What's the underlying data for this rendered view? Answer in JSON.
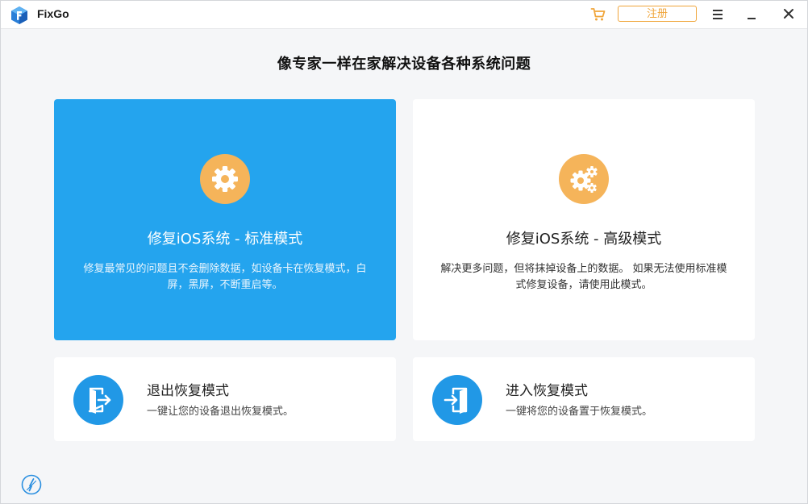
{
  "app": {
    "title": "FixGo"
  },
  "titlebar": {
    "register_label": "注册",
    "icons": [
      "cart-icon",
      "menu-icon",
      "minimize-icon",
      "close-icon"
    ]
  },
  "headline": "像专家一样在家解决设备各种系统问题",
  "modes": [
    {
      "title": "修复iOS系统 - 标准模式",
      "description": "修复最常见的问题且不会删除数据，如设备卡在恢复模式，白屏，黑屏，不断重启等。",
      "icon": "gear-icon",
      "selected": true
    },
    {
      "title": "修复iOS系统 - 高级模式",
      "description": "解决更多问题，但将抹掉设备上的数据。 如果无法使用标准模式修复设备，请使用此模式。",
      "icon": "gears-icon",
      "selected": false
    }
  ],
  "recovery": [
    {
      "title": "退出恢复模式",
      "description": "一键让您的设备退出恢复模式。",
      "icon": "exit-door-icon"
    },
    {
      "title": "进入恢复模式",
      "description": "一键将您的设备置于恢复模式。",
      "icon": "enter-door-icon"
    }
  ],
  "colors": {
    "accent_blue": "#24a4ee",
    "icon_orange": "#f5b45a",
    "register_orange": "#f0a53a",
    "background": "#f5f6f8"
  }
}
